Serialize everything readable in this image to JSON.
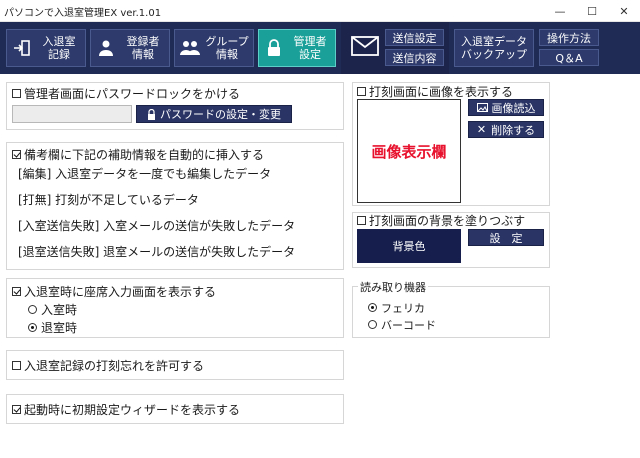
{
  "window": {
    "title": "パソコンで入退室管理EX ver.1.01",
    "minimize": "—",
    "maximize": "☐",
    "close": "✕"
  },
  "toolbar": {
    "entry_record": "入退室\n記録",
    "registrant_info": "登録者\n情報",
    "group_info": "グループ\n情報",
    "admin_settings": "管理者\n設定",
    "send_settings": "送信設定",
    "send_content": "送信内容",
    "backup": "入退室データ\nバックアップ",
    "manual": "操作方法",
    "qa": "Q＆A"
  },
  "password_lock": {
    "label": "管理者画面にパスワードロックをかける",
    "checked": false,
    "button": "パスワードの設定・変更"
  },
  "remarks": {
    "label": "備考欄に下記の補助情報を自動的に挿入する",
    "checked": true,
    "lines": [
      "[編集]  入退室データを一度でも編集したデータ",
      "[打無]  打刻が不足しているデータ",
      "[入室送信失敗]  入室メールの送信が失敗したデータ",
      "[退室送信失敗]  退室メールの送信が失敗したデータ"
    ]
  },
  "seat_input": {
    "label": "入退室時に座席入力画面を表示する",
    "checked": true,
    "options": [
      "入室時",
      "退室時"
    ],
    "selected": "退室時"
  },
  "allow_forget": {
    "label": "入退室記録の打刻忘れを許可する",
    "checked": false
  },
  "wizard": {
    "label": "起動時に初期設定ウィザードを表示する",
    "checked": true
  },
  "stamp_image": {
    "label": "打刻画面に画像を表示する",
    "checked": false,
    "placeholder": "画像表示欄",
    "load_button": "画像読込",
    "delete_button": "削除する"
  },
  "stamp_background": {
    "label": "打刻画面の背景を塗りつぶす",
    "checked": false,
    "swatch_label": "背景色",
    "setting_button": "設　定"
  },
  "reader": {
    "legend": "読み取り機器",
    "options": [
      "フェリカ",
      "バーコード"
    ],
    "selected": "フェリカ"
  },
  "colors": {
    "toolbar_bg": "#1f2a55",
    "active_tab": "#1aa098",
    "accent_red": "#e8112d",
    "dark_button": "#2a3566"
  }
}
